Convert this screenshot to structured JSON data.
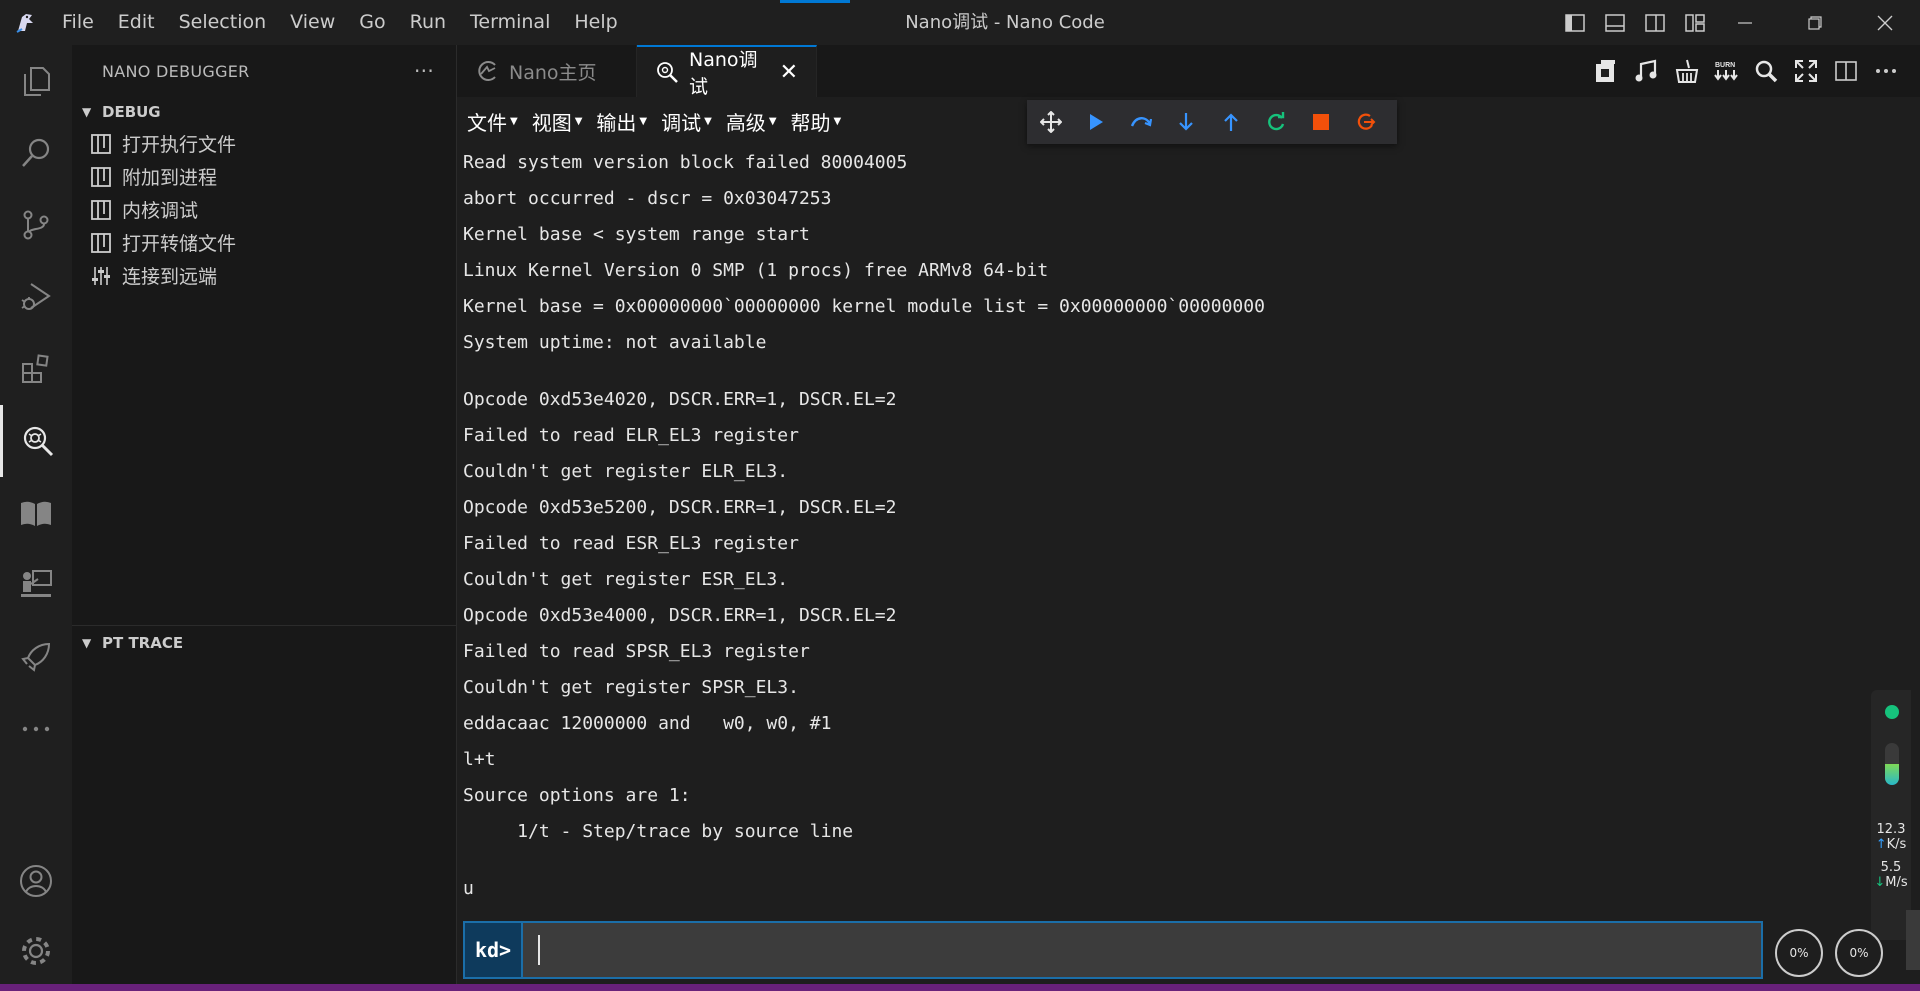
{
  "window": {
    "title": "Nano调试 - Nano Code",
    "menu": [
      "File",
      "Edit",
      "Selection",
      "View",
      "Go",
      "Run",
      "Terminal",
      "Help"
    ],
    "controls": [
      "minimize-icon",
      "restore-icon",
      "close-icon"
    ]
  },
  "activity_bar": {
    "items": [
      "explorer-icon",
      "search-icon",
      "source-control-icon",
      "run-debug-icon",
      "extensions-icon",
      "nano-debugger-icon",
      "book-icon",
      "presenter-icon",
      "rocket-icon",
      "more-icon"
    ],
    "bottom": [
      "account-icon",
      "settings-gear-icon"
    ]
  },
  "sidebar": {
    "header": "NANO DEBUGGER",
    "more": "···",
    "debug_section": "DEBUG",
    "items": [
      {
        "label": "打开执行文件",
        "icon": "panel-icon"
      },
      {
        "label": "附加到进程",
        "icon": "panel-icon"
      },
      {
        "label": "内核调试",
        "icon": "panel-icon"
      },
      {
        "label": "打开转储文件",
        "icon": "panel-icon"
      },
      {
        "label": "连接到远端",
        "icon": "sliders-icon"
      }
    ],
    "pt_section": "PT TRACE"
  },
  "tabs": [
    {
      "label": "Nano主页",
      "active": false
    },
    {
      "label": "Nano调试",
      "active": true,
      "close": "✕"
    }
  ],
  "webview": {
    "menu": [
      "文件",
      "视图",
      "输出",
      "调试",
      "高级",
      "帮助"
    ],
    "toolbar": {
      "colors": {
        "play": "#3794ff",
        "step": "#3794ff",
        "restart": "#16c27c",
        "stop": "#f2500a"
      }
    },
    "console_lines": [
      "Read system version block failed 80004005",
      "abort occurred - dscr = 0x03047253",
      "Kernel base < system range start",
      "Linux Kernel Version 0 SMP (1 procs) free ARMv8 64-bit",
      "Kernel base = 0x00000000`00000000 kernel module list = 0x00000000`00000000",
      "System uptime: not available",
      "",
      "Opcode 0xd53e4020, DSCR.ERR=1, DSCR.EL=2",
      "Failed to read ELR_EL3 register",
      "Couldn't get register ELR_EL3.",
      "Opcode 0xd53e5200, DSCR.ERR=1, DSCR.EL=2",
      "Failed to read ESR_EL3 register",
      "Couldn't get register ESR_EL3.",
      "Opcode 0xd53e4000, DSCR.ERR=1, DSCR.EL=2",
      "Failed to read SPSR_EL3 register",
      "Couldn't get register SPSR_EL3.",
      "eddacaac 12000000 and   w0, w0, #1",
      "l+t",
      "Source options are 1:",
      "     1/t - Step/trace by source line",
      "",
      "u"
    ],
    "prompt": "kd>",
    "input_value": "",
    "gauge1": "0%",
    "gauge2": "0%",
    "netmon": {
      "up_value": "12.3",
      "up_unit": "K/s",
      "down_value": "5.5",
      "down_unit": "M/s",
      "level": 0.5
    }
  }
}
